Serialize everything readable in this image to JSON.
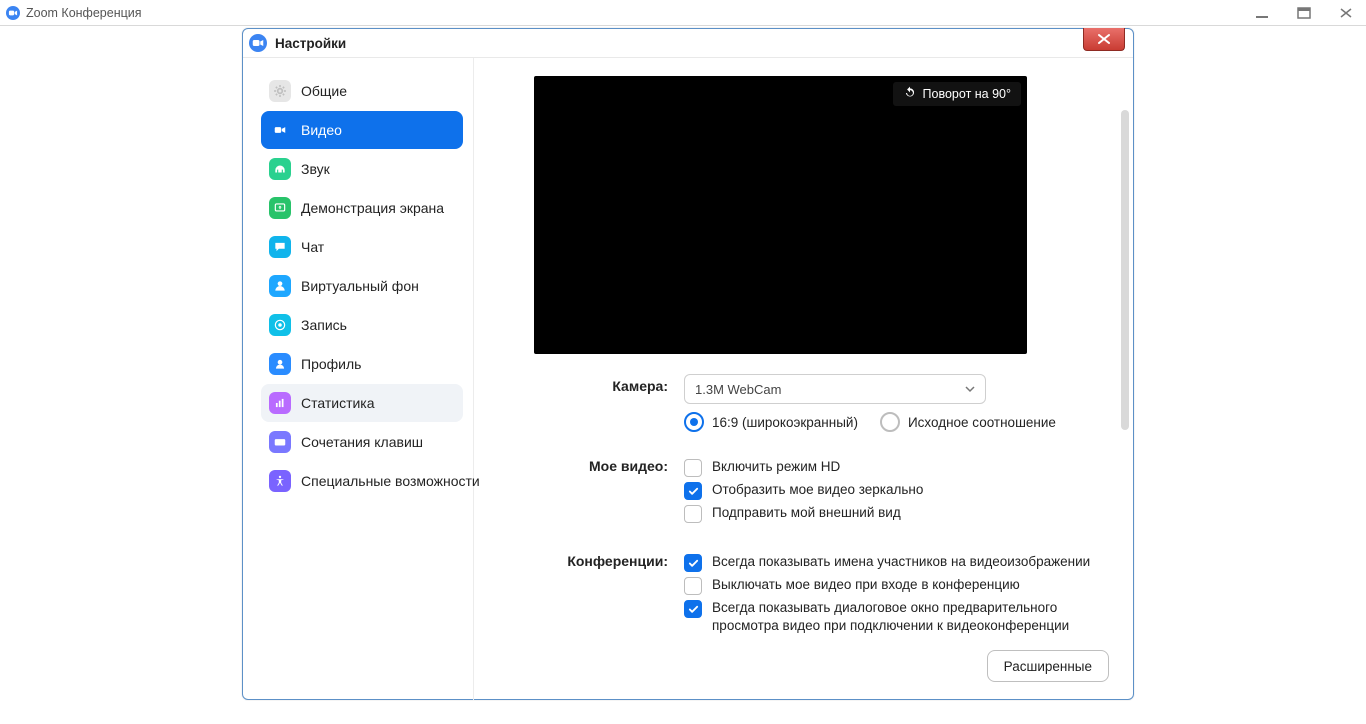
{
  "outer_window": {
    "title": "Zoom Конференция"
  },
  "dialog": {
    "title": "Настройки",
    "sidebar": {
      "items": [
        {
          "id": "general",
          "label": "Общие",
          "icon_bg": "#e6e6e6",
          "icon_fg": "#bfbfbf",
          "icon": "gear"
        },
        {
          "id": "video",
          "label": "Видео",
          "icon_bg": "#ffffff",
          "icon_fg": "#ffffff",
          "icon": "video",
          "active": true
        },
        {
          "id": "audio",
          "label": "Звук",
          "icon_bg": "#2ad18f",
          "icon_fg": "#ffffff",
          "icon": "headphones"
        },
        {
          "id": "share",
          "label": "Демонстрация экрана",
          "icon_bg": "#28c36a",
          "icon_fg": "#ffffff",
          "icon": "share"
        },
        {
          "id": "chat",
          "label": "Чат",
          "icon_bg": "#10b4ec",
          "icon_fg": "#ffffff",
          "icon": "chat"
        },
        {
          "id": "vbg",
          "label": "Виртуальный фон",
          "icon_bg": "#1ea7ff",
          "icon_fg": "#ffffff",
          "icon": "person"
        },
        {
          "id": "record",
          "label": "Запись",
          "icon_bg": "#10c0e8",
          "icon_fg": "#ffffff",
          "icon": "record"
        },
        {
          "id": "profile",
          "label": "Профиль",
          "icon_bg": "#2a8cff",
          "icon_fg": "#ffffff",
          "icon": "profile"
        },
        {
          "id": "stats",
          "label": "Статистика",
          "icon_bg": "#b96bff",
          "icon_fg": "#ffffff",
          "icon": "bars",
          "hover": true
        },
        {
          "id": "shortcuts",
          "label": "Сочетания клавиш",
          "icon_bg": "#7a78ff",
          "icon_fg": "#ffffff",
          "icon": "keyboard"
        },
        {
          "id": "accessibility",
          "label": "Специальные возможности",
          "icon_bg": "#7a63ff",
          "icon_fg": "#ffffff",
          "icon": "accessibility"
        }
      ]
    },
    "video": {
      "rotate_label": "Поворот на 90°",
      "camera_label": "Камера:",
      "camera_value": "1.3M WebCam",
      "aspect": {
        "wide": "16:9 (широкоэкранный)",
        "original": "Исходное соотношение",
        "selected": "wide"
      },
      "my_video_label": "Мое видео:",
      "my_video_opts": [
        {
          "id": "hd",
          "label": "Включить режим HD",
          "checked": false
        },
        {
          "id": "mirror",
          "label": "Отобразить мое видео зеркально",
          "checked": true
        },
        {
          "id": "touchup",
          "label": "Подправить мой внешний вид",
          "checked": false
        }
      ],
      "meetings_label": "Конференции:",
      "meeting_opts": [
        {
          "id": "names",
          "label": "Всегда показывать имена участников на видеоизображении",
          "checked": true
        },
        {
          "id": "offjoin",
          "label": "Выключать мое видео при входе в конференцию",
          "checked": false
        },
        {
          "id": "preview",
          "label": "Всегда показывать диалоговое окно предварительного просмотра видео при подключении к видеоконференции",
          "checked": true
        }
      ],
      "advanced_label": "Расширенные"
    }
  }
}
